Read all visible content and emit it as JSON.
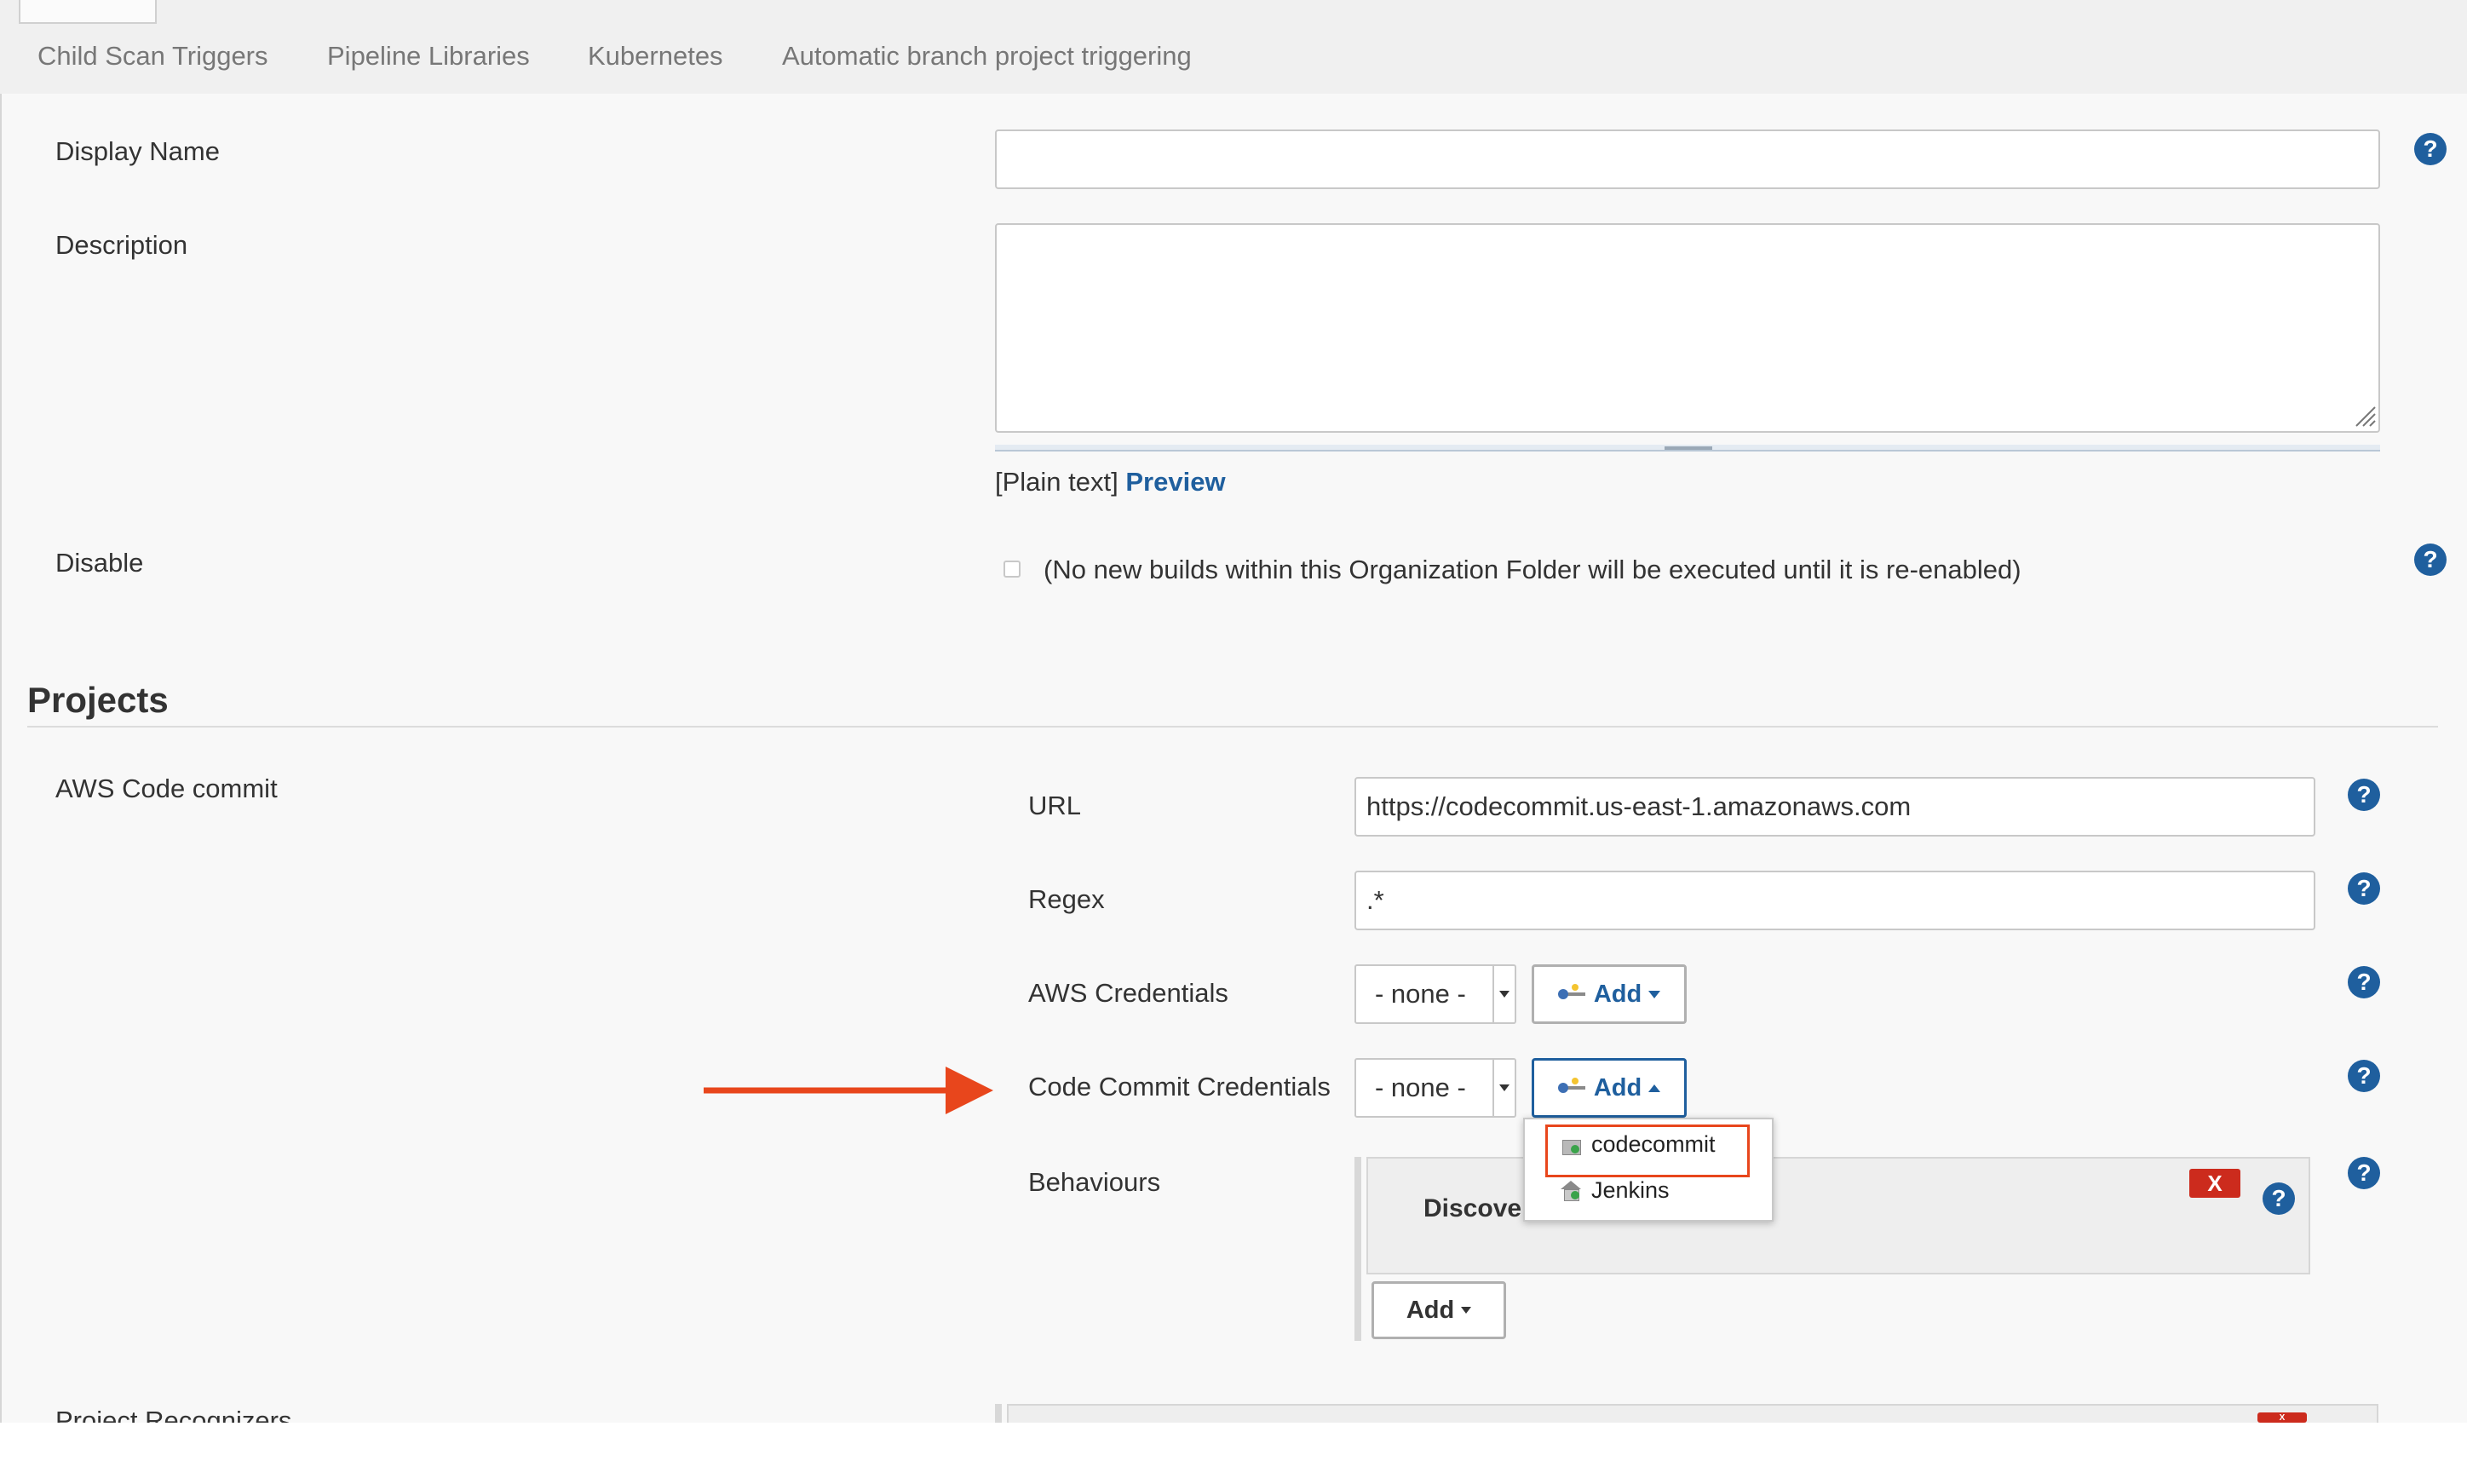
{
  "tabs": [
    {
      "label": "Child Scan Triggers"
    },
    {
      "label": "Pipeline Libraries"
    },
    {
      "label": "Kubernetes"
    },
    {
      "label": "Automatic branch project triggering"
    }
  ],
  "general": {
    "display_name": {
      "label": "Display Name",
      "value": ""
    },
    "description": {
      "label": "Description",
      "value": "",
      "format_text": "[Plain text]",
      "preview_link": "Preview"
    },
    "disable": {
      "label": "Disable",
      "checked": false,
      "note": "(No new builds within this Organization Folder will be executed until it is re-enabled)"
    }
  },
  "projects": {
    "heading": "Projects",
    "section_label": "AWS Code commit",
    "url": {
      "label": "URL",
      "value": "https://codecommit.us-east-1.amazonaws.com"
    },
    "regex": {
      "label": "Regex",
      "value": ".*"
    },
    "aws_credentials": {
      "label": "AWS Credentials",
      "selected": "- none -",
      "add_label": "Add"
    },
    "codecommit_credentials": {
      "label": "Code Commit Credentials",
      "selected": "- none -",
      "add_label": "Add",
      "menu_items": [
        "codecommit",
        "Jenkins"
      ]
    },
    "behaviours": {
      "label": "Behaviours",
      "item_title": "Discove",
      "remove_label": "X",
      "add_label": "Add"
    },
    "project_recognizers": {
      "label": "Project Recognizers",
      "remove_label": "X"
    }
  },
  "help_icon_text": "?",
  "annotation_colors": {
    "arrow": "#e8461c",
    "highlight": "#e8461c"
  }
}
